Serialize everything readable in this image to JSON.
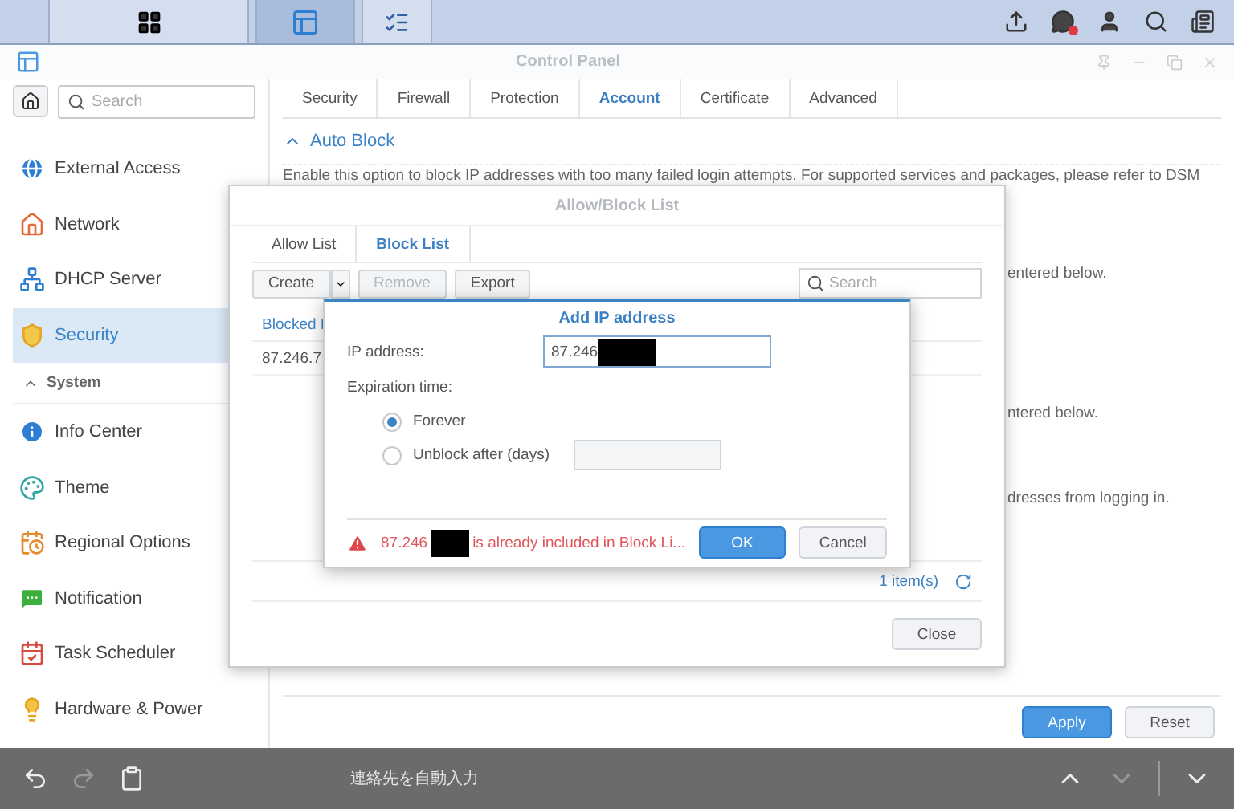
{
  "taskbar": {
    "apps": [
      {
        "selected": false
      },
      {
        "selected": true
      },
      {
        "selected": false
      }
    ],
    "has_notification": true
  },
  "window": {
    "title": "Control Panel"
  },
  "sidebar": {
    "search_placeholder": "Search",
    "items": [
      {
        "kind": "item",
        "label": "External Access",
        "selected": false
      },
      {
        "kind": "item",
        "label": "Network",
        "selected": false
      },
      {
        "kind": "item",
        "label": "DHCP Server",
        "selected": false
      },
      {
        "kind": "item",
        "label": "Security",
        "selected": true
      },
      {
        "kind": "header",
        "label": "System",
        "expanded": true
      },
      {
        "kind": "item",
        "label": "Info Center",
        "selected": false
      },
      {
        "kind": "item",
        "label": "Theme",
        "selected": false
      },
      {
        "kind": "item",
        "label": "Regional Options",
        "selected": false
      },
      {
        "kind": "item",
        "label": "Notification",
        "selected": false
      },
      {
        "kind": "item",
        "label": "Task Scheduler",
        "selected": false
      },
      {
        "kind": "item",
        "label": "Hardware & Power",
        "selected": false
      }
    ]
  },
  "tabs": [
    {
      "label": "Security",
      "selected": false
    },
    {
      "label": "Firewall",
      "selected": false
    },
    {
      "label": "Protection",
      "selected": false
    },
    {
      "label": "Account",
      "selected": true
    },
    {
      "label": "Certificate",
      "selected": false
    },
    {
      "label": "Advanced",
      "selected": false
    }
  ],
  "section": {
    "title": "Auto Block",
    "expanded": true,
    "description": "Enable this option to block IP addresses with too many failed login attempts. For supported services and packages, please refer to DSM",
    "fragments": [
      "entered below.",
      "ntered below.",
      "dresses from logging in."
    ]
  },
  "buttons": [
    {
      "label": "Apply",
      "kind": "primary"
    },
    {
      "label": "Reset",
      "kind": "default"
    }
  ],
  "list_dialog": {
    "title": "Allow/Block List",
    "tabs": [
      {
        "label": "Allow List",
        "selected": false
      },
      {
        "label": "Block List",
        "selected": true
      }
    ],
    "toolbar": [
      {
        "label": "Create",
        "kind": "split",
        "disabled": false
      },
      {
        "label": "Remove",
        "kind": "plain",
        "disabled": true
      },
      {
        "label": "Export",
        "kind": "plain",
        "disabled": false
      }
    ],
    "search_placeholder": "Search",
    "columns": [
      "Blocked I"
    ],
    "rows": [
      [
        "87.246.7"
      ]
    ],
    "count": "1 item(s)",
    "close": "Close"
  },
  "add_dialog": {
    "title": "Add IP address",
    "ip_label": "IP address:",
    "ip_value": "87.246",
    "expiration_label": "Expiration time:",
    "options": [
      {
        "label": "Forever",
        "selected": true,
        "kind": "plain"
      },
      {
        "label": "Unblock after (days)",
        "selected": false,
        "kind": "days"
      }
    ],
    "error": {
      "before": "87.246",
      "after": "is already included in Block Li..."
    },
    "buttons": [
      {
        "label": "OK",
        "kind": "primary"
      },
      {
        "label": "Cancel",
        "kind": "default"
      }
    ]
  },
  "keyboard_bar": {
    "suggestion": "連絡先を自動入力"
  }
}
